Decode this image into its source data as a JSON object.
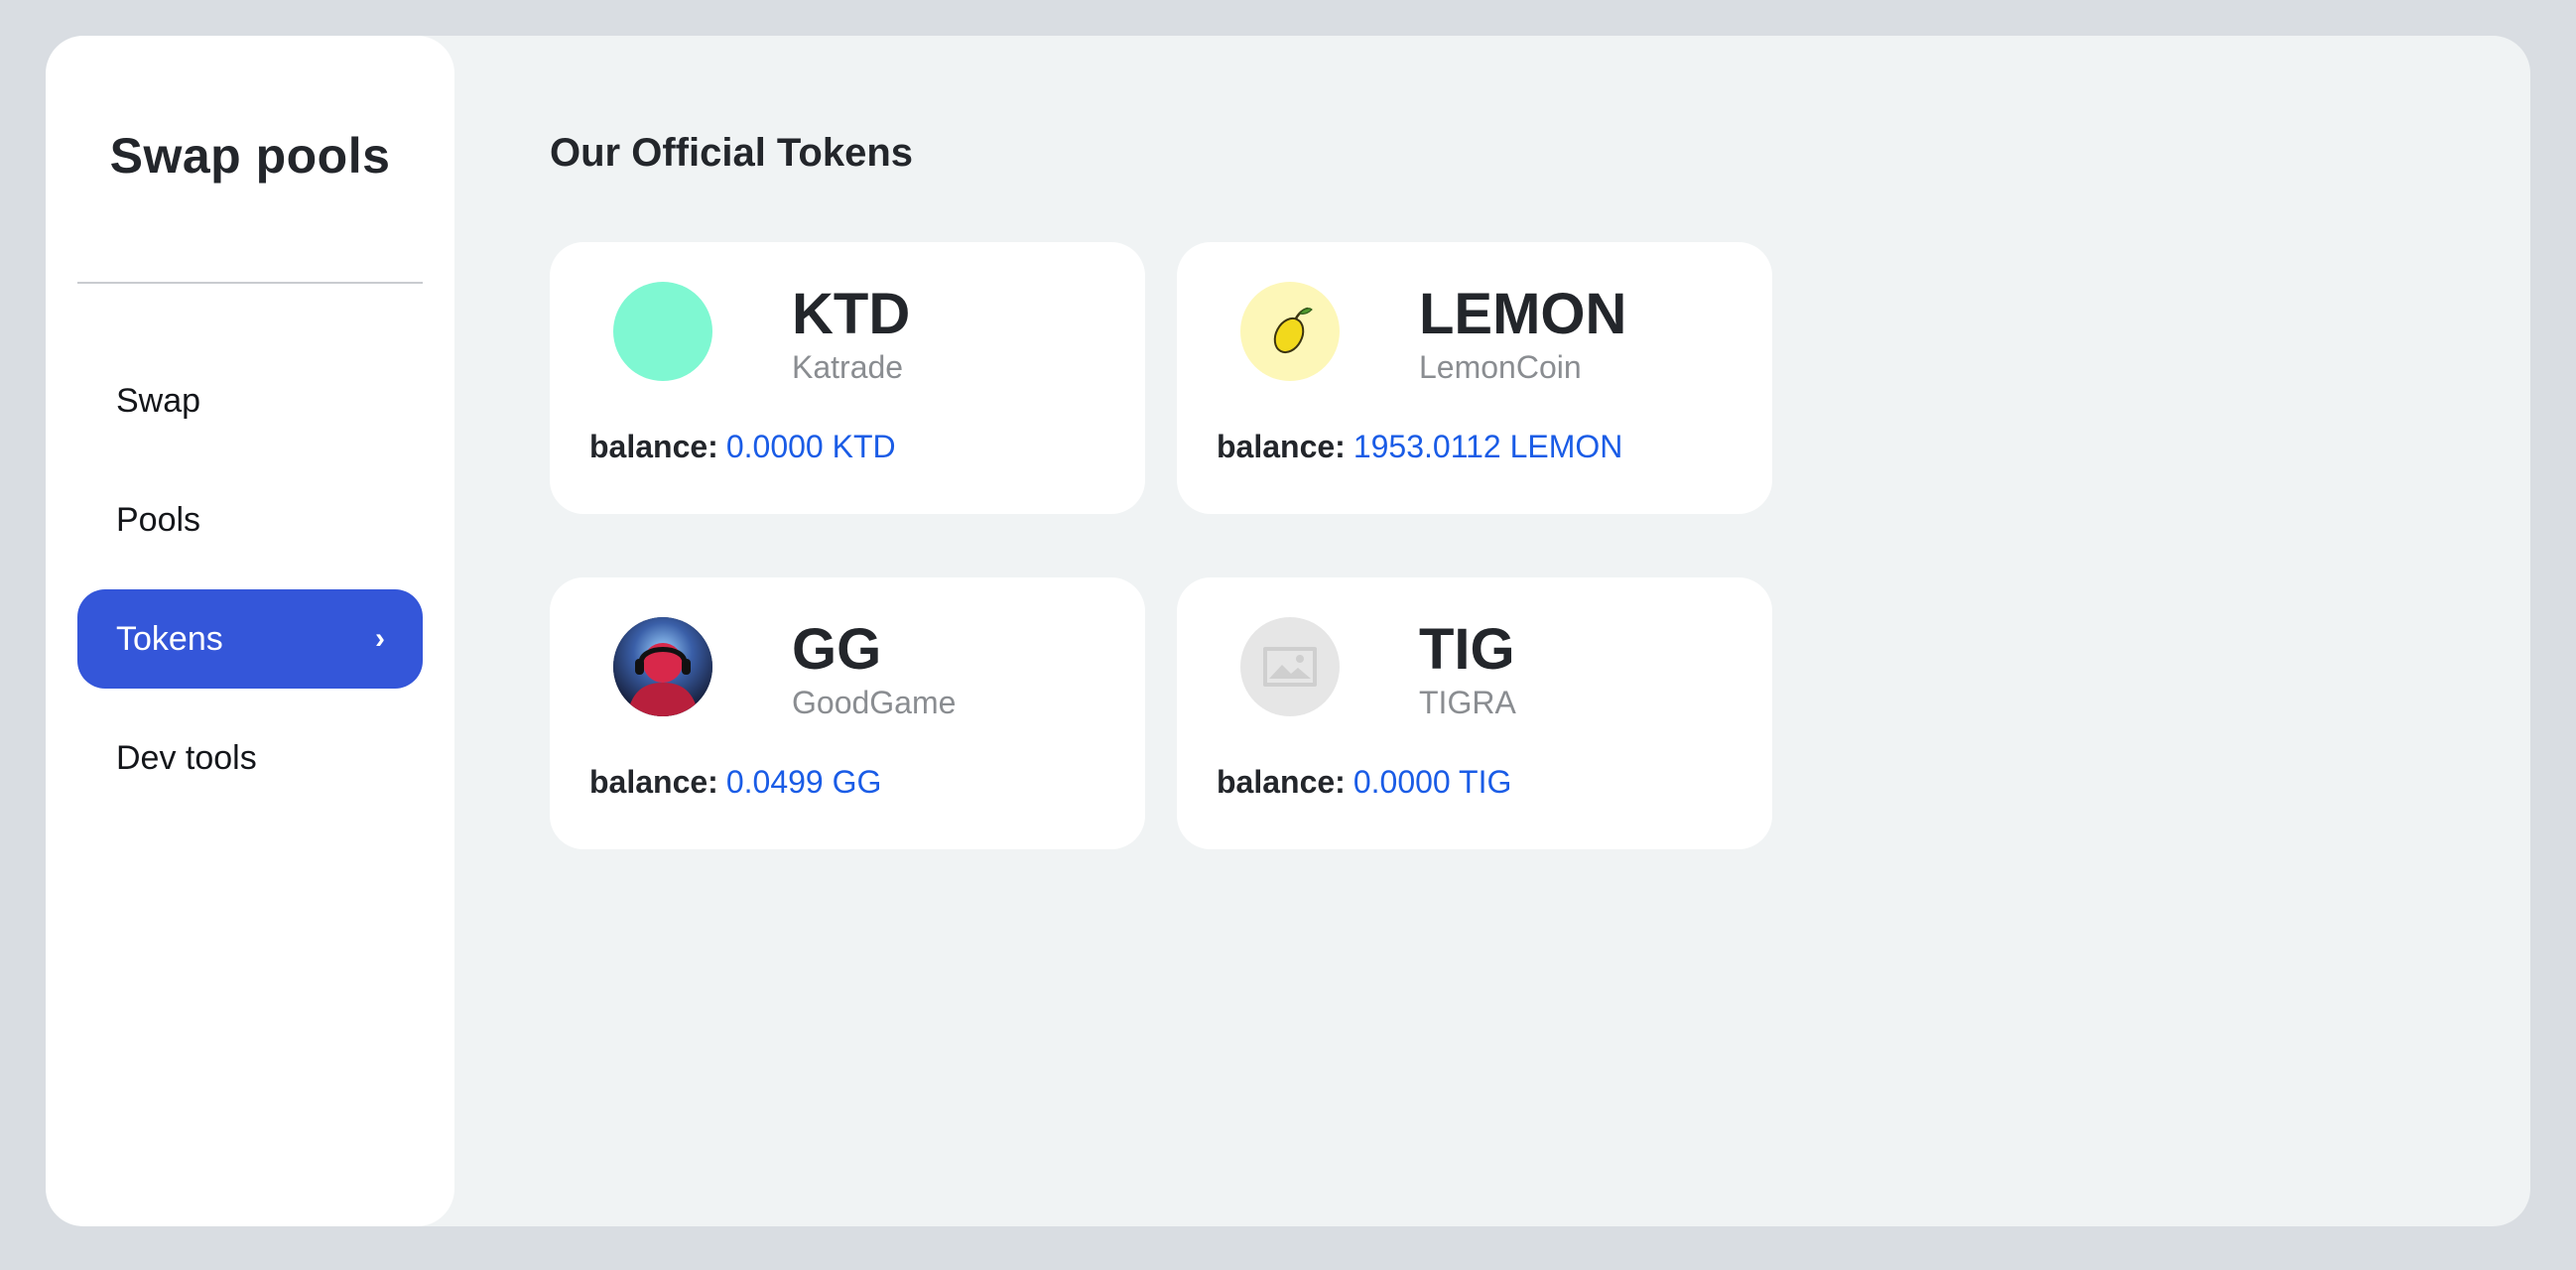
{
  "sidebar": {
    "title": "Swap pools",
    "items": [
      {
        "label": "Swap"
      },
      {
        "label": "Pools"
      },
      {
        "label": "Tokens",
        "active": true
      },
      {
        "label": "Dev tools"
      }
    ],
    "chevron": "›"
  },
  "main": {
    "section_title": "Our Official Tokens",
    "balance_label": "balance:",
    "tokens": [
      {
        "symbol": "KTD",
        "name": "Katrade",
        "balance": "0.0000 KTD",
        "icon": "ktd-token-icon",
        "color": "#7ff8d2"
      },
      {
        "symbol": "LEMON",
        "name": "LemonCoin",
        "balance": "1953.0112 LEMON",
        "icon": "lemon-icon",
        "color": "#fdf7b8"
      },
      {
        "symbol": "GG",
        "name": "GoodGame",
        "balance": "0.0499 GG",
        "icon": "gamer-avatar-icon",
        "color": "#1f2a4d"
      },
      {
        "symbol": "TIG",
        "name": "TIGRA",
        "balance": "0.0000 TIG",
        "icon": "image-placeholder-icon",
        "color": "#e6e6e6"
      }
    ]
  },
  "colors": {
    "accent": "#3456d9",
    "balance_value": "#1a5ce6",
    "page_background": "#f0f3f4"
  }
}
